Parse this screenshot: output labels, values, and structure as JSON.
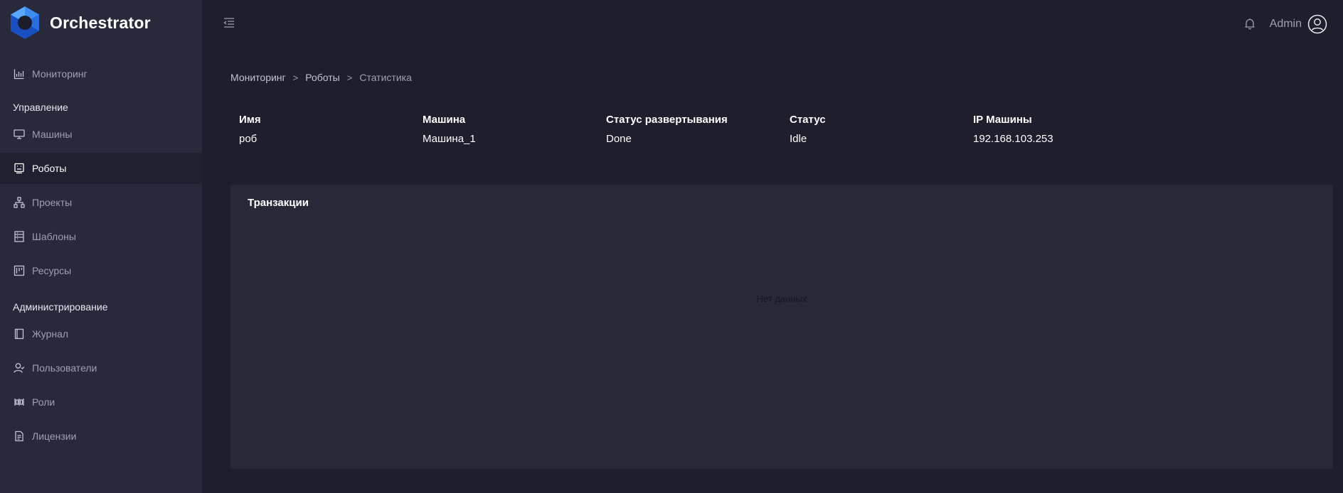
{
  "app": {
    "title": "Orchestrator"
  },
  "sidebar": {
    "items": [
      {
        "label": "Мониторинг",
        "icon": "chart-icon"
      },
      {
        "label": "Машины",
        "icon": "monitor-icon"
      },
      {
        "label": "Роботы",
        "icon": "robot-icon",
        "active": true
      },
      {
        "label": "Проекты",
        "icon": "hierarchy-icon"
      },
      {
        "label": "Шаблоны",
        "icon": "template-icon"
      },
      {
        "label": "Ресурсы",
        "icon": "resources-icon"
      },
      {
        "label": "Журнал",
        "icon": "journal-icon"
      },
      {
        "label": "Пользователи",
        "icon": "users-icon"
      },
      {
        "label": "Роли",
        "icon": "roles-icon"
      },
      {
        "label": "Лицензии",
        "icon": "license-icon"
      }
    ],
    "sections": {
      "management": "Управление",
      "administration": "Администрирование"
    }
  },
  "header": {
    "user": "Admin"
  },
  "breadcrumb": {
    "items": [
      "Мониторинг",
      "Роботы",
      "Статистика"
    ],
    "separator": ">"
  },
  "robot_info": {
    "columns": [
      "Имя",
      "Машина",
      "Статус развертывания",
      "Статус",
      "IP Машины"
    ],
    "values": [
      "роб",
      "Машина_1",
      "Done",
      "Idle",
      "192.168.103.253"
    ]
  },
  "transactions": {
    "title": "Транзакции",
    "empty_text": "Нет данных"
  },
  "colors": {
    "background": "#1e1e2d",
    "sidebar": "#282a3c",
    "card": "#272838",
    "active_item": "#1f2030",
    "muted_text": "#9ea0b2",
    "logo_blue": "#2f6fe0"
  }
}
